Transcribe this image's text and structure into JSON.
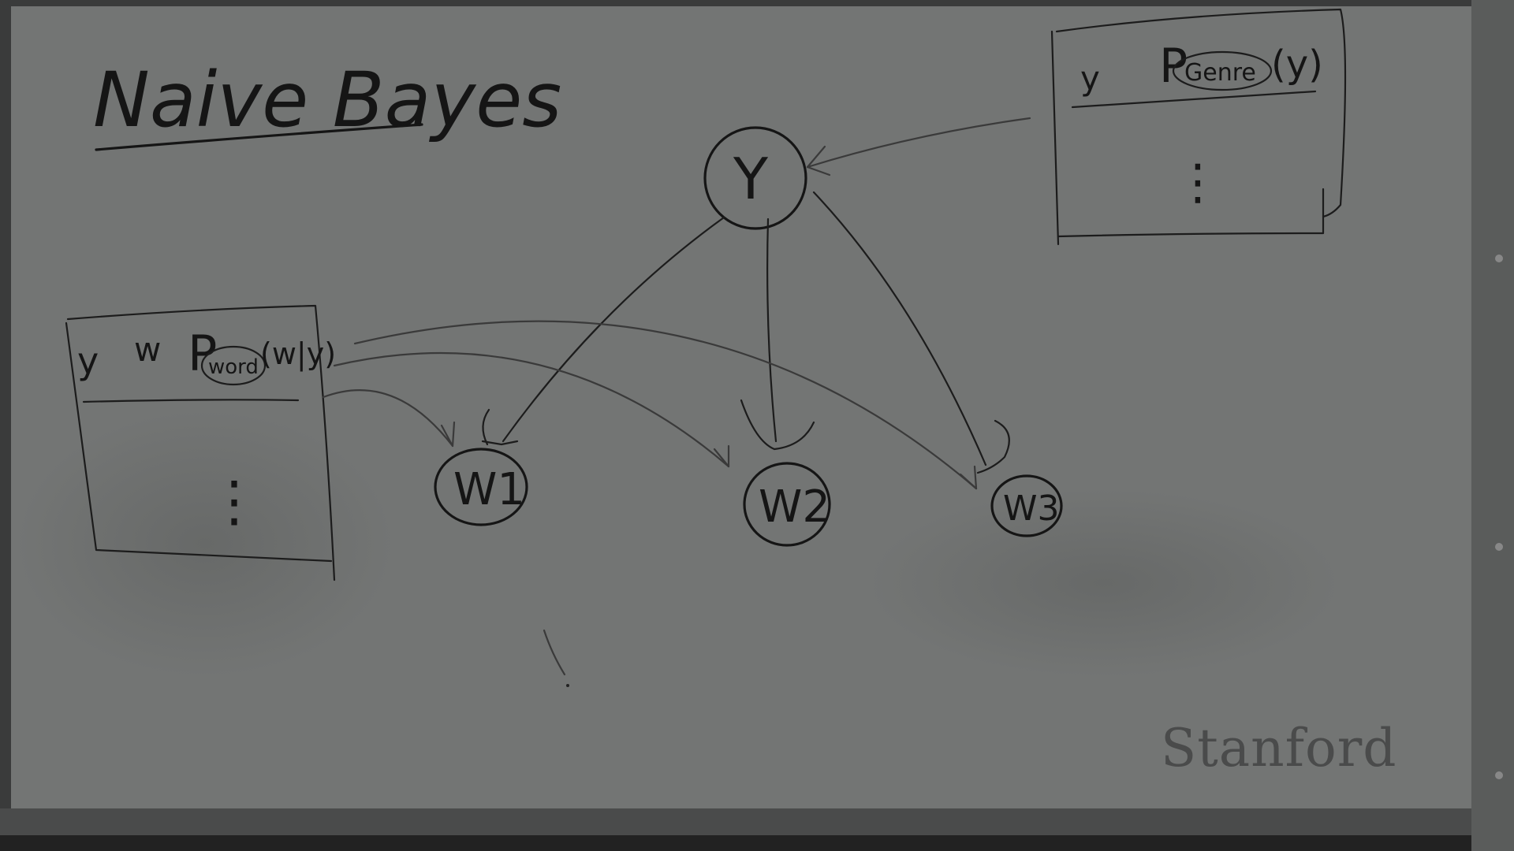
{
  "title": "Naive Bayes",
  "prior_table": {
    "col1": "y",
    "col2_prefix": "P",
    "col2_subscript": "Genre",
    "col2_arg": "(y)",
    "dots": "⋮"
  },
  "likelihood_table": {
    "col1": "y",
    "col2": "w",
    "col3_prefix": "P",
    "col3_subscript": "word",
    "col3_arg": "(w|y)",
    "dots": "⋮"
  },
  "nodes": {
    "class_node": "Y",
    "word1": "W1",
    "word2": "W2",
    "word3": "W3"
  },
  "watermark": "Stanford",
  "colors": {
    "board": "#737574",
    "frame": "#2f3030",
    "ink": "#151515",
    "watermark": "#4a4b4b"
  }
}
